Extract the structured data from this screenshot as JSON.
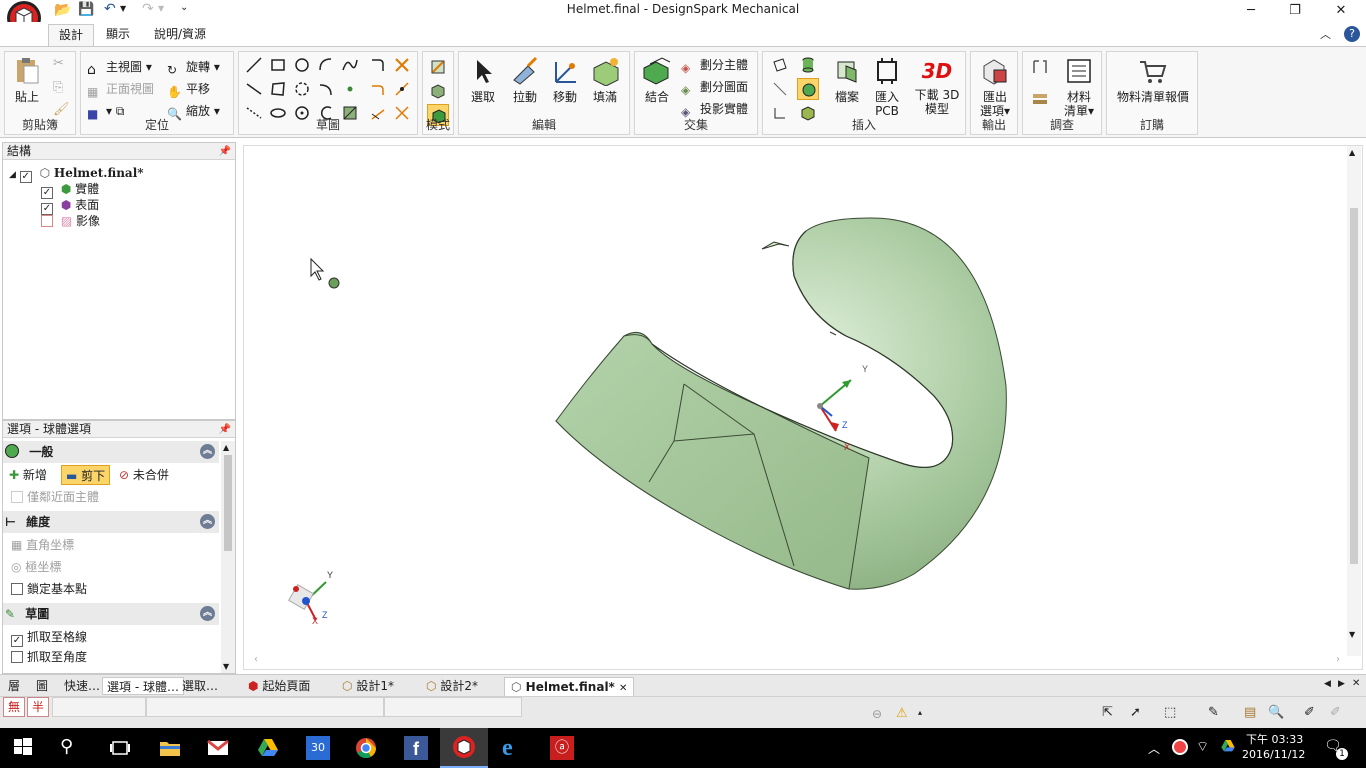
{
  "window": {
    "title": "Helmet.final - DesignSpark Mechanical",
    "minimize": "─",
    "maximize": "❐",
    "close": "✕"
  },
  "ribbon_tabs": [
    "設計",
    "顯示",
    "說明/資源"
  ],
  "groups": {
    "clipboard": {
      "label": "剪貼簿",
      "paste": "貼上"
    },
    "orient": {
      "label": "定位",
      "home_view": "主視圖",
      "front_view": "正面視圖",
      "rotate": "旋轉",
      "pan": "平移",
      "zoom": "縮放"
    },
    "sketch": {
      "label": "草圖"
    },
    "mode": {
      "label": "模式"
    },
    "edit": {
      "label": "編輯",
      "select": "選取",
      "pull": "拉動",
      "move": "移動",
      "fill": "填滿"
    },
    "intersect": {
      "label": "交集",
      "combine": "結合",
      "split_body": "劃分主體",
      "split_surface": "劃分圖面",
      "project_body": "投影實體"
    },
    "insert": {
      "label": "插入",
      "file": "檔案",
      "import_pcb_1": "匯入",
      "import_pcb_2": "PCB",
      "download_3d_1": "下載 3D",
      "download_3d_2": "模型",
      "three_d": "3D"
    },
    "output": {
      "label": "輸出",
      "export_1": "匯出",
      "export_2": "選項"
    },
    "investigate": {
      "label": "調查",
      "bom_1": "材料",
      "bom_2": "清單"
    },
    "order": {
      "label": "訂購",
      "quote": "物料清單報價"
    }
  },
  "structure": {
    "header": "結構",
    "root": "Helmet.final*",
    "items": [
      "實體",
      "表面",
      "影像"
    ]
  },
  "options": {
    "header": "選項 - 球體選項",
    "general": {
      "title": "一般",
      "add": "新增",
      "cut": "剪下",
      "no_merge": "未合併",
      "tangent": "僅鄰近面主體"
    },
    "dimension": {
      "title": "維度",
      "cartesian": "直角坐標",
      "polar": "極坐標",
      "lock_base": "鎖定基本點"
    },
    "sketch": {
      "title": "草圖",
      "snap_grid": "抓取至格線",
      "snap_angle": "抓取至角度"
    }
  },
  "left_tabs": [
    "層",
    "圖",
    "快速…",
    "選項 - 球體…",
    "選取…"
  ],
  "doc_tabs": [
    "起始頁面",
    "設計1*",
    "設計2*",
    "Helmet.final*"
  ],
  "ime": {
    "mode": "無",
    "width": "半"
  },
  "axes": {
    "x": "X",
    "y": "Y",
    "z": "Z"
  },
  "taskbar": {
    "time_1": "下午 03:33",
    "time_2": "2016/11/12",
    "notifications": "1"
  },
  "colors": {
    "accent": "#2b579a",
    "model": "#a9caa0",
    "model_dark": "#6f9a66"
  }
}
